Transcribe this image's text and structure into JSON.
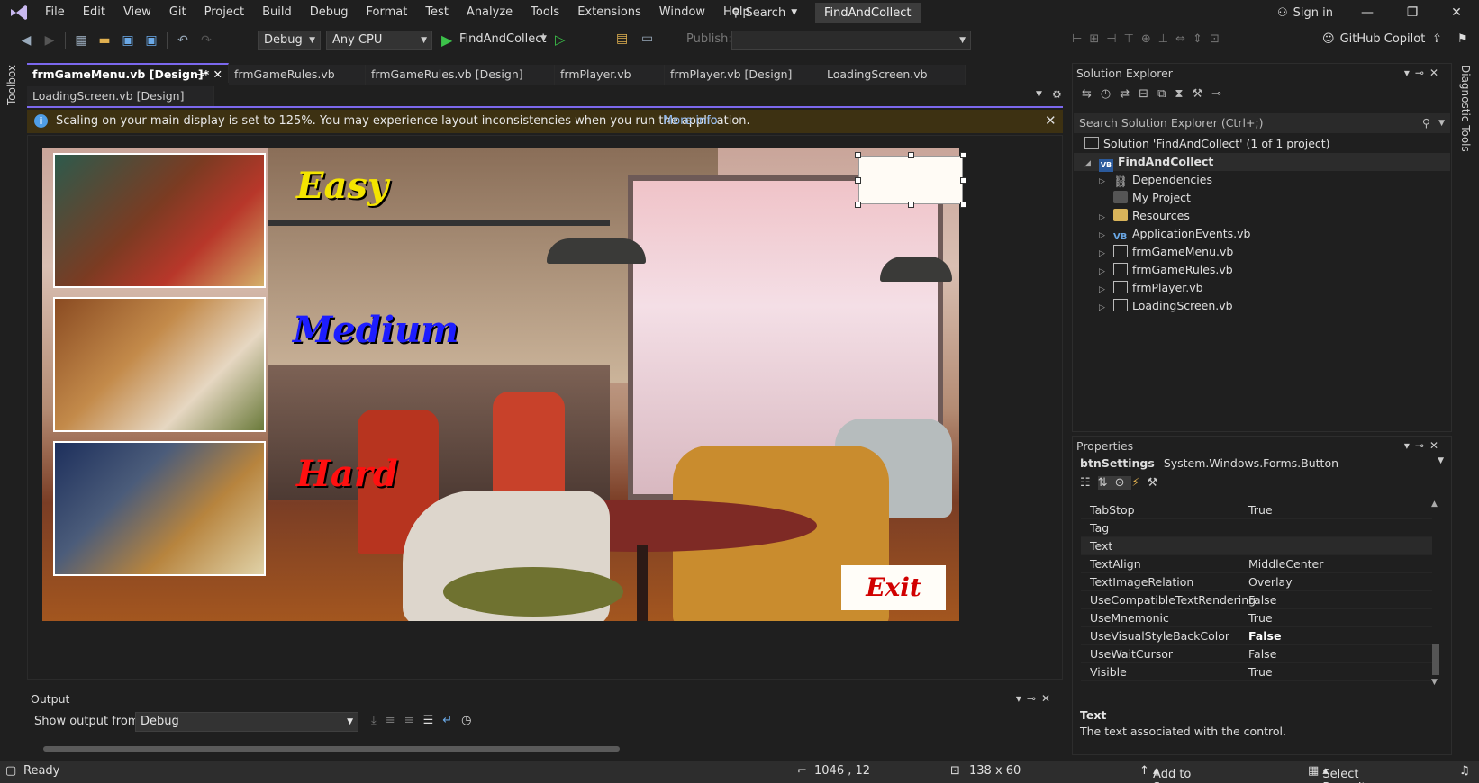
{
  "menubar": {
    "items": [
      "File",
      "Edit",
      "View",
      "Git",
      "Project",
      "Build",
      "Debug",
      "Format",
      "Test",
      "Analyze",
      "Tools",
      "Extensions",
      "Window",
      "Help"
    ],
    "search": "Search",
    "project": "FindAndCollect",
    "signin": "Sign in"
  },
  "toolbar": {
    "config": "Debug",
    "platform": "Any CPU",
    "run_target": "FindAndCollect",
    "publish_label": "Publish:",
    "copilot": "GitHub Copilot"
  },
  "side": {
    "toolbox": "Toolbox",
    "diagnostics": "Diagnostic Tools"
  },
  "tabs": [
    "frmGameMenu.vb [Design]*",
    "frmGameRules.vb",
    "frmGameRules.vb [Design]",
    "frmPlayer.vb",
    "frmPlayer.vb [Design]",
    "LoadingScreen.vb",
    "LoadingScreen.vb [Design]"
  ],
  "infobar": {
    "message": "Scaling on your main display is set to 125%. You may experience layout inconsistencies when you run the application.",
    "link": "More info"
  },
  "form": {
    "levels": {
      "easy": "Easy",
      "medium": "Medium",
      "hard": "Hard"
    },
    "exit": "Exit",
    "colors": {
      "easy": "#f4e400",
      "medium": "#1d1dff",
      "hard": "#ff1010"
    }
  },
  "output": {
    "title": "Output",
    "show_from_label": "Show output from:",
    "source": "Debug"
  },
  "solution_explorer": {
    "title": "Solution Explorer",
    "search_placeholder": "Search Solution Explorer (Ctrl+;)",
    "solution": "Solution 'FindAndCollect' (1 of 1 project)",
    "project": "FindAndCollect",
    "items": [
      "Dependencies",
      "My Project",
      "Resources",
      "ApplicationEvents.vb",
      "frmGameMenu.vb",
      "frmGameRules.vb",
      "frmPlayer.vb",
      "LoadingScreen.vb"
    ]
  },
  "properties": {
    "title": "Properties",
    "object": "btnSettings",
    "object_type": "System.Windows.Forms.Button",
    "rows": [
      {
        "name": "TabStop",
        "value": "True"
      },
      {
        "name": "Tag",
        "value": ""
      },
      {
        "name": "Text",
        "value": ""
      },
      {
        "name": "TextAlign",
        "value": "MiddleCenter"
      },
      {
        "name": "TextImageRelation",
        "value": "Overlay"
      },
      {
        "name": "UseCompatibleTextRendering",
        "value": "False"
      },
      {
        "name": "UseMnemonic",
        "value": "True"
      },
      {
        "name": "UseVisualStyleBackColor",
        "value": "False"
      },
      {
        "name": "UseWaitCursor",
        "value": "False"
      },
      {
        "name": "Visible",
        "value": "True"
      }
    ],
    "desc_title": "Text",
    "desc": "The text associated with the control."
  },
  "status": {
    "ready": "Ready",
    "position": "1046 , 12",
    "size": "138 x 60",
    "source_control": "Add to Source Control",
    "repository": "Select Repository"
  }
}
